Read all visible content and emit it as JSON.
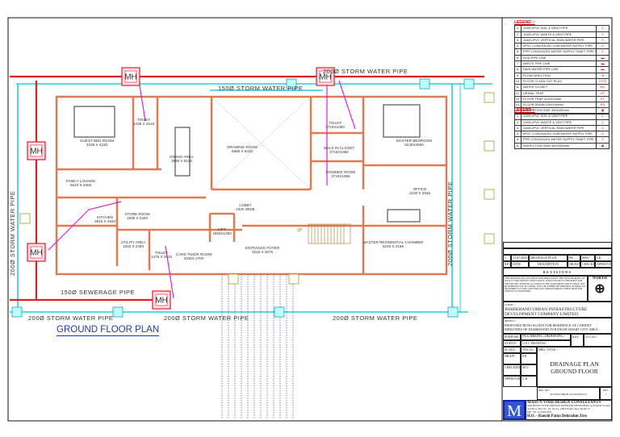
{
  "drawing": {
    "title": "GROUND FLOOR PLAN",
    "pipes": {
      "storm_top": "200Ø STORM WATER PIPE",
      "storm_top_inner": "150Ø STORM WATER PIPE",
      "storm_left": "200Ø STORM WATER PIPE",
      "storm_right": "200Ø STORM WATER PIPE",
      "sewerage": "150Ø SEWERAGE PIPE",
      "storm_bottom_1": "200Ø STORM WATER PIPE",
      "storm_bottom_2": "200Ø STORM WATER PIPE",
      "storm_bottom_3": "200Ø STORM WATER PIPE"
    },
    "manhole_label": "MH",
    "stair_up": "UP",
    "rooms": [
      {
        "name": "GUEST BED ROOM",
        "size": "4165 X 4150"
      },
      {
        "name": "TOILET",
        "size": "1438 X 1518"
      },
      {
        "name": "DINING AREA",
        "size": "3550 X 8120"
      },
      {
        "name": "FAMILY LOUNGE",
        "size": "6610 X 2605"
      },
      {
        "name": "DRAWING ROOM",
        "size": "6960 X 6430"
      },
      {
        "name": "TOILET",
        "size": "3715X1050"
      },
      {
        "name": "WALK IN CLOSET",
        "size": "3715X1950"
      },
      {
        "name": "POWDER ROOM",
        "size": "3715X1955"
      },
      {
        "name": "MASTER BEDROOM",
        "size": "5240X4550"
      },
      {
        "name": "OFFICE",
        "size": "3100 X 2936"
      },
      {
        "name": "LOBBY",
        "size": "2320 WIDE"
      },
      {
        "name": "KITCHEN",
        "size": "3915 X 4940"
      },
      {
        "name": "STORE ROOM",
        "size": "1930 X 2320"
      },
      {
        "name": "UTILITY AREA",
        "size": "1815 X 2490"
      },
      {
        "name": "TOILET",
        "size": "1475 X 2015"
      },
      {
        "name": "CARE TAKER ROOM",
        "size": "3340X 2700"
      },
      {
        "name": "LIFT",
        "size": "1650X1250"
      },
      {
        "name": "ENTRANCE FOYER",
        "size": "3215 X 3675"
      },
      {
        "name": "MASTER RESIDENTIAL CHAMBER",
        "size": "5240 X 4166"
      }
    ]
  },
  "legend1": {
    "title": "LEGEND :-",
    "items": [
      {
        "n": "1.",
        "d": "110Ø uPVC SOIL & VENT PIPE",
        "s": "1"
      },
      {
        "n": "2.",
        "d": "110Ø uPVC WASTE & VENT PIPE",
        "s": "2"
      },
      {
        "n": "3.",
        "d": "110Ø uPVC VERTICAL RAIN WATER PIPE",
        "s": "3"
      },
      {
        "n": "4.",
        "d": "cPVC CONCEALED CUM WATER SUPPLY PIPE",
        "s": "4"
      },
      {
        "n": "5.",
        "d": "PPR CONCEALED WATER SUPPLY SHAFT PIPE TO OVER HEAD TANK",
        "s": "5"
      },
      {
        "n": "6.",
        "d": "SOIL PIPE LINE",
        "s": "▬"
      },
      {
        "n": "7.",
        "d": "WASTE PIPE LINE",
        "s": "▬"
      },
      {
        "n": "8.",
        "d": "RAIN WATER PIPE LINE",
        "s": "▬"
      },
      {
        "n": "9.",
        "d": "FLOW DIRECTION",
        "s": "➔"
      },
      {
        "n": "10.",
        "d": "FLOOR CLEAN OUT PLUG",
        "s": "FCO"
      },
      {
        "n": "11.",
        "d": "WATER CLOSET",
        "s": "WC"
      },
      {
        "n": "12.",
        "d": "URINAL TRAP",
        "s": "UT"
      },
      {
        "n": "13.",
        "d": "FLOOR TRAP 110X110mm",
        "s": "FT"
      },
      {
        "n": "14.",
        "d": "FLOOR DRAIN 100X100mm",
        "s": "FD"
      },
      {
        "n": "15.",
        "d": "INSPECTION SIDE 450X450mm",
        "s": "▦"
      }
    ]
  },
  "legend2": {
    "title": "LEGEND :-",
    "items": [
      {
        "n": "1.",
        "d": "110Ø uPVC SOIL & VENT PIPE",
        "s": "1"
      },
      {
        "n": "2.",
        "d": "110Ø uPVC WASTE & VENT PIPE",
        "s": "2"
      },
      {
        "n": "3.",
        "d": "110Ø uPVC VERTICAL RAIN WATER PIPE",
        "s": "3"
      },
      {
        "n": "4.",
        "d": "cPVC CONCEALED CUM WATER SUPPLY PIPE",
        "s": "4"
      },
      {
        "n": "5.",
        "d": "PPR CONCEALED WATER SUPPLY SHAFT PIPE TO OVER HEAD TANK",
        "s": "5"
      },
      {
        "n": "6.",
        "d": "INSPECTION SIDE 450X450mm",
        "s": "▦"
      }
    ]
  },
  "title_block": {
    "rev_row": {
      "rev": "1",
      "date": "13.07.2023",
      "description": "DRAINAGE PLAN",
      "drawn": "PK",
      "checked": "MSO",
      "approved": "CK"
    },
    "headers": {
      "rev": "REV.",
      "date": "DATE",
      "description": "DESCRIPTION",
      "drawn": "DRAWN",
      "checked": "CHECKED",
      "approved": "APPROVED"
    },
    "revisions": "REVISIONS",
    "note": "THIS DRAWING HAS NOT BEEN PUBLISHED AND IS THE SOLE PROPERTY OF MASS N VOID DESIGN CONSULTANTS, AND IS ISSUED TO THE PARTY FOR THE SPECIFIC PURPOSE AS STATED IN THE AGREEMENT AND IT SHALL NOT BE REPRODUCED OR COPIED, LENT OR OTHERWISE DISPOSED OF DIRECTLY OR INDIRECTLY, NOR USED FOR ANY OTHER PURPOSE OTHER THAN FOR WHICH IT IS FURNISHED.",
    "north": "NORTH",
    "client_label": "CLIENT :-",
    "client": "JHARKHAND URBAN INFRASTRUCTURE DEVELOPMENT COMPANY LIMITED.",
    "project_label": "PROJECT :-",
    "project": "PROPOSED BUNGALOWS FOR RESIDENCE OF CABINET MINISTERS OF JHARKHAND IN RANCHI SMART CITY AREA.",
    "purpose_label": "PURPOSE",
    "purpose": "PLUMBING DRAWING",
    "date_label": "DATE",
    "date": "10.07.2023",
    "status_label": "STATUS",
    "status": "G.F.C DRAWING",
    "scale_label": "SCALE :",
    "scale": "NTS.A3",
    "drg_title_label": "DRG. TITLE :-",
    "drg_title_1": "DRAINAGE PLAN",
    "drg_title_2": "GROUND FLOOR",
    "draft_label": "DRAFT",
    "draft": "P.K",
    "checked_label": "CHECKED",
    "checked": "M.O",
    "approved_label": "APPROVED",
    "approved": "C.K",
    "drg_no_label": "DRG. NO :-",
    "drg_no": "2023/MNV/MR-BL/PL/DR/WD/P-01",
    "rev_label": "REV.",
    "rev": "1",
    "firm": "MASS N VOID DESIGN CONSULTANTS",
    "firm_group": "(A Pramati Group)",
    "firm_tag": "ARCHITECTS ENGINEERS INTERIOR DESIGNERS",
    "firm_addr": "3rd Floor Plot No. 16, Sector-12B Dwarka New Delhi 75",
    "firm_ph": "PH: +91 11-45612955",
    "firm_ho": "H.O. - Ranchi  Patna  Dehradun  Ziro",
    "logo_text": "M"
  },
  "colors": {
    "wall": "#e07a55",
    "sewer": "#e02020",
    "storm": "#22d0e0",
    "door": "#2233bb",
    "plumb": "#e020e0"
  }
}
